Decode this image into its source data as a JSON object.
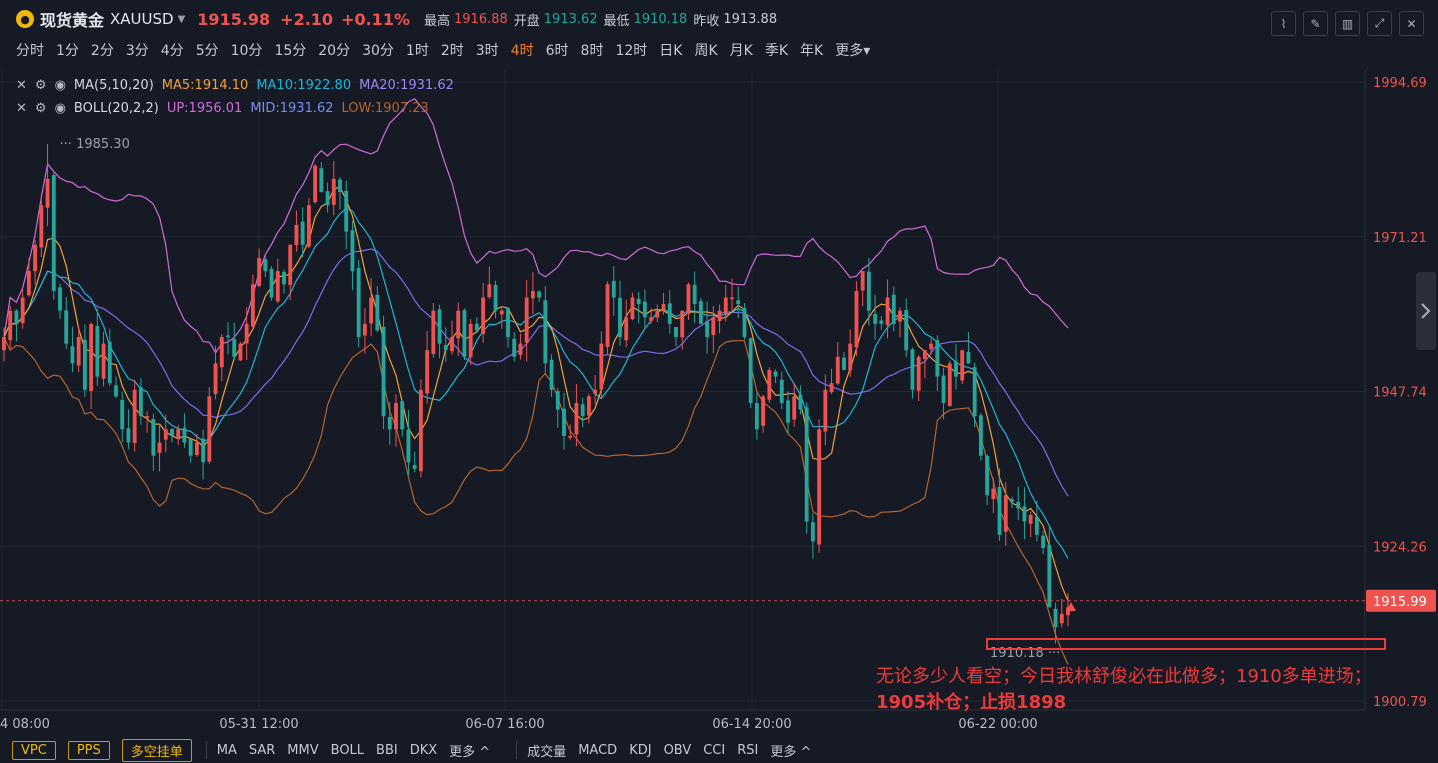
{
  "header": {
    "logo_icon": "gold-coin-icon",
    "name": "现货黄金",
    "symbol": "XAUUSD",
    "price": "1915.98",
    "change": "+2.10",
    "change_pct": "+0.11%",
    "high_label": "最高",
    "high": "1916.88",
    "open_label": "开盘",
    "open": "1913.62",
    "low_label": "最低",
    "low": "1910.18",
    "prev_close_label": "昨收",
    "prev_close": "1913.88"
  },
  "periods": [
    "分时",
    "1分",
    "2分",
    "3分",
    "4分",
    "5分",
    "10分",
    "15分",
    "20分",
    "30分",
    "1时",
    "2时",
    "3时",
    "4时",
    "6时",
    "8时",
    "12时",
    "日K",
    "周K",
    "月K",
    "季K",
    "年K",
    "更多"
  ],
  "active_period": "4时",
  "legend": {
    "ma": {
      "name": "MA(5,10,20)",
      "ma5": "MA5:1914.10",
      "ma10": "MA10:1922.80",
      "ma20": "MA20:1931.62"
    },
    "boll": {
      "name": "BOLL(20,2,2)",
      "up": "UP:1956.01",
      "mid": "MID:1931.62",
      "low": "LOW:1907.23"
    }
  },
  "bottom": {
    "buttons": [
      "VPC",
      "PPS",
      "多空挂单"
    ],
    "indicators1": [
      "MA",
      "SAR",
      "MMV",
      "BOLL",
      "BBI",
      "DKX",
      "更多"
    ],
    "indicators2": [
      "成交量",
      "MACD",
      "KDJ",
      "OBV",
      "CCI",
      "RSI",
      "更多"
    ]
  },
  "annotation": {
    "line1": "无论多少人看空；今日我林舒俊必在此做多；1910多单进场；",
    "line2": "1905补仓；止损1898"
  },
  "colors": {
    "up": "#ef5350",
    "down": "#26a69a",
    "ma5": "#f0a23b",
    "ma10": "#1fb5d6",
    "ma20": "#7b6cf0",
    "boll_up": "#d16bd8",
    "boll_low": "#b5652d"
  },
  "chart_data": {
    "type": "candlestick",
    "x_ticks": [
      "4 08:00",
      "05-31 12:00",
      "06-07 16:00",
      "06-14 20:00",
      "06-22 00:00"
    ],
    "y_ticks": [
      "1994.69",
      "1971.21",
      "1947.74",
      "1924.26",
      "1900.79"
    ],
    "ylim": [
      1900.79,
      1994.69
    ],
    "current_price": "1915.99",
    "max_label": "1985.30",
    "min_label": "1910.18",
    "series": {
      "close": [
        1956,
        1960,
        1958,
        1962,
        1966,
        1970,
        1976,
        1980,
        1963,
        1960,
        1955,
        1952,
        1956,
        1948,
        1958,
        1950,
        1955,
        1949,
        1947,
        1942,
        1940,
        1948,
        1944,
        1944,
        1938,
        1940,
        1942,
        1941,
        1942,
        1940,
        1938,
        1940,
        1937,
        1947,
        1952,
        1956,
        1956,
        1953,
        1955,
        1958,
        1964,
        1968,
        1966,
        1962,
        1966,
        1964,
        1970,
        1973,
        1970,
        1976,
        1982,
        1978,
        1976,
        1980,
        1978,
        1972,
        1966,
        1956,
        1958,
        1962,
        1957,
        1944,
        1942,
        1946,
        1942,
        1937,
        1936,
        1948,
        1954,
        1960,
        1955,
        1954,
        1956,
        1960,
        1953,
        1958,
        1957,
        1962,
        1964,
        1960,
        1960,
        1956,
        1953,
        1955,
        1962,
        1963,
        1962,
        1952,
        1948,
        1945,
        1941,
        1941,
        1946,
        1944,
        1947,
        1948,
        1955,
        1964,
        1962,
        1956,
        1959,
        1962,
        1961,
        1959,
        1959,
        1960,
        1961,
        1958,
        1956,
        1960,
        1964,
        1961,
        1958,
        1956,
        1959,
        1960,
        1962,
        1962,
        1961,
        1956,
        1946,
        1942,
        1947,
        1951,
        1950,
        1946,
        1943,
        1947,
        1945,
        1928,
        1925,
        1942,
        1948,
        1949,
        1953,
        1951,
        1955,
        1963,
        1966,
        1960,
        1958,
        1958,
        1962,
        1958,
        1960,
        1954,
        1948,
        1953,
        1954,
        1955,
        1950,
        1946,
        1952,
        1950,
        1954,
        1952,
        1944,
        1938,
        1932,
        1933,
        1926,
        1932,
        1931,
        1930,
        1928,
        1929,
        1926,
        1924,
        1915,
        1912,
        1914,
        1915
      ]
    },
    "ma_last": {
      "ma5": 1914.1,
      "ma10": 1922.8,
      "ma20": 1931.62
    },
    "boll_last": {
      "up": 1956.01,
      "mid": 1931.62,
      "low": 1907.23
    }
  }
}
